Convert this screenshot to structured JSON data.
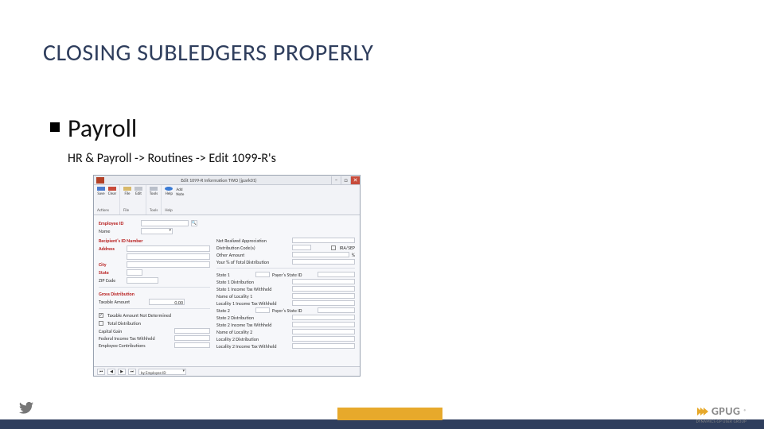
{
  "slide": {
    "title": "CLOSING SUBLEDGERS PROPERLY",
    "bullet": "Payroll",
    "navpath": "HR & Payroll -> Routines -> Edit 1099-R's"
  },
  "shot": {
    "window_title": "Edit 1099-R Information    TWO (jpark01)",
    "winbtns": {
      "min": "–",
      "max": "□",
      "close": "✕"
    },
    "ribbon": {
      "actions": {
        "save": "Save",
        "clear": "Clear",
        "group": "Actions"
      },
      "file": {
        "file": "File",
        "edit": "Edit",
        "group": "File"
      },
      "tools": {
        "tools": "Tools",
        "group": "Tools"
      },
      "help": {
        "help": "Help",
        "add": "Add Note",
        "group": "Help"
      }
    },
    "left_labels": {
      "employee_id": "Employee ID",
      "name": "Name",
      "recipients_id": "Recipient's ID Number",
      "address": "Address",
      "city": "City",
      "state": "State",
      "zip": "ZIP Code",
      "gross_dist": "Gross Distribution",
      "taxable_amt": "Taxable Amount"
    },
    "right_labels": [
      "Net Realized Appreciation",
      "Distribution Code(s)",
      "Other Amount",
      "Your % of Total Distribution",
      "State 1",
      "State 1 Distribution",
      "State 1 Income Tax Withheld",
      "Name of Locality 1",
      "Locality 1 Income Tax Withheld",
      "State 2",
      "State 2 Distribution",
      "State 2 Income Tax Withheld",
      "Name of Locality 2",
      "Locality 2 Distribution",
      "Locality 2 Income Tax Withheld"
    ],
    "state_header_right": {
      "s1r": "Payer's State ID",
      "s2r": "Payer's State ID"
    },
    "ira_sep": "IRA/SEP",
    "pct_symbol": "%",
    "checks": {
      "taxable_not_det": "Taxable Amount Not Determined",
      "total_dist": "Total Distribution"
    },
    "bottom_labels": [
      "Capital Gain",
      "Federal Income Tax Withheld",
      "Employee Contributions"
    ],
    "zero_val": "0.00",
    "lookup_glyph": "🔍",
    "check_glyph": "✓",
    "status": {
      "by": "by Employee ID",
      "first": "⏮",
      "prev": "◀",
      "next": "▶",
      "last": "⏭"
    }
  },
  "footer": {
    "logo_text": "GPUG",
    "logo_sub": "DYNAMICS GP USER GROUP",
    "reg": "®"
  }
}
